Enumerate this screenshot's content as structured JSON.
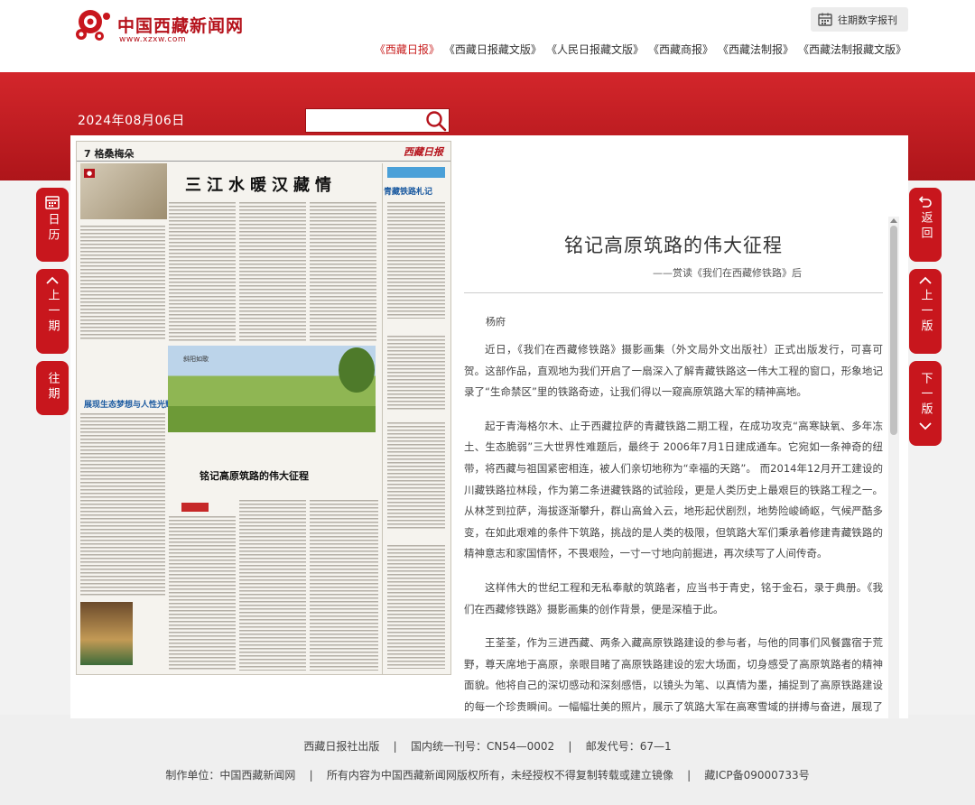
{
  "site": {
    "logo_name": "中国西藏新闻网",
    "logo_url": "www.xzxw.com",
    "archive_button": "往期数字报刊"
  },
  "nav": [
    {
      "label": "《西藏日报》",
      "active": true
    },
    {
      "label": "《西藏日报藏文版》",
      "active": false
    },
    {
      "label": "《人民日报藏文版》",
      "active": false
    },
    {
      "label": "《西藏商报》",
      "active": false
    },
    {
      "label": "《西藏法制报》",
      "active": false
    },
    {
      "label": "《西藏法制报藏文版》",
      "active": false
    }
  ],
  "toolbar": {
    "date": "2024年08月06日",
    "search_placeholder": ""
  },
  "side_buttons": {
    "calendar": "日历",
    "prev_issue": "上一期",
    "archive": "往期",
    "back": "返回",
    "prev_page": "上一版",
    "next_page": "下一版"
  },
  "paper": {
    "page_label": "7  格桑梅朵",
    "masthead": "西藏日报",
    "headline": "三江水暖汉藏情",
    "feature_title": "铭记高原筑路的伟大征程",
    "left_feature": "展现生态梦想与人性光辉",
    "sidebar_title": "青藏铁路札记",
    "photo_label": "斜阳如歌"
  },
  "article": {
    "title": "铭记高原筑路的伟大征程",
    "subtitle": "——赏读《我们在西藏修铁路》后",
    "author": "杨府",
    "paragraphs": [
      "近日，《我们在西藏修铁路》摄影画集（外文局外文出版社）正式出版发行，可喜可贺。这部作品，直观地为我们开启了一扇深入了解青藏铁路这一伟大工程的窗口，形象地记录了“生命禁区”里的铁路奇迹，让我们得以一窥高原筑路大军的精神高地。",
      "起于青海格尔木、止于西藏拉萨的青藏铁路二期工程，在成功攻克“高寒缺氧、多年冻土、生态脆弱”三大世界性难题后，最终于 2006年7月1日建成通车。它宛如一条神奇的纽带，将西藏与祖国紧密相连，被人们亲切地称为“幸福的天路”。 而2014年12月开工建设的川藏铁路拉林段，作为第二条进藏铁路的试验段，更是人类历史上最艰巨的铁路工程之一。从林芝到拉萨，海拔逐渐攀升，群山高耸入云，地形起伏剧烈，地势险峻崎岖，气候严酷多变，在如此艰难的条件下筑路，挑战的是人类的极限，但筑路大军们秉承着修建青藏铁路的精神意志和家国情怀，不畏艰险，一寸一寸地向前掘进，再次续写了人间传奇。",
      "这样伟大的世纪工程和无私奉献的筑路者，应当书于青史，铭于金石，录于典册。《我们在西藏修铁路》摄影画集的创作背景，便是深植于此。",
      "王荃荃，作为三进西藏、两条入藏高原铁路建设的参与者，与他的同事们风餐露宿于荒野，尊天席地于高原，亲眼目睹了高原铁路建设的宏大场面，切身感受了高原筑路者的精神面貌。他将自己的深切感动和深刻感悟，以镜头为笔、以真情为墨，捕捉到了高原铁路建设的每一个珍贵瞬间。一幅幅壮美的照片，展示了筑路大军在高寒雪域的拼搏与奋进，展现了青藏铁路、川藏铁路（拉林段）的神奇魅力，也揭示了西藏因高原铁路建设而"
    ]
  },
  "footer": {
    "line1": "西藏日报社出版    |    国内统一刊号：CN54—0002    |    邮发代号：67—1",
    "line2": "制作单位：中国西藏新闻网    |    所有内容为中国西藏新闻网版权所有，未经授权不得复制转载或建立镜像    |    藏ICP备09000733号"
  },
  "colors": {
    "brand_red": "#c8161d",
    "nav_active": "#c81e1e"
  }
}
